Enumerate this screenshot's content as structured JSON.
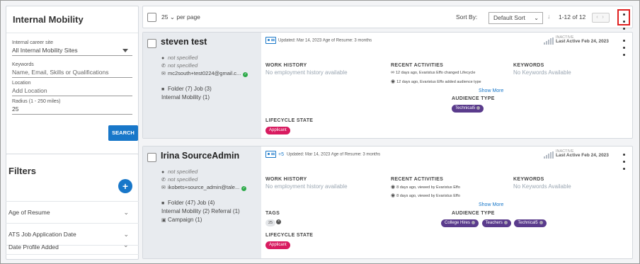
{
  "left": {
    "title": "Internal Mobility",
    "site_label": "Internal career site",
    "site_value": "All Internal Mobility Sites",
    "keywords_label": "Keywords",
    "keywords_placeholder": "Name, Email, Skills or Qualifications",
    "location_label": "Location",
    "location_placeholder": "Add Location",
    "radius_label": "Radius (1 - 250 miles)",
    "radius_value": "25",
    "search_label": "SEARCH",
    "filters_title": "Filters",
    "add_label": "+",
    "filters": [
      "Age of Resume",
      "ATS Job Application Date",
      "Date Profile Added"
    ]
  },
  "topbar": {
    "per_page": "25",
    "per_page_label": "per page",
    "sort_by": "Sort By:",
    "sort_value": "Default Sort",
    "pagination": "1-12 of 12"
  },
  "records": [
    {
      "name": "steven test",
      "location": "not specified",
      "phone": "not specified",
      "email": "mc2south+test0224@gmail.c...",
      "folder_job": "Folder (7)  Job (3)",
      "source1": "Internal Mobility (1)",
      "resume": "Updated: Mar 14, 2023  Age of Resume: 3 months",
      "status": "INACTIVE",
      "last_active": "Last Active Feb 24, 2023",
      "work_history_h": "WORK HISTORY",
      "work_history": "No employment history available",
      "recent_h": "RECENT ACTIVITIES",
      "act1": "12 days ago, Evaristus Effo changed Lifecycle",
      "act2": "12 days ago, Evaristus Effo added audience type",
      "show_more": "Show More",
      "keywords_h": "KEYWORDS",
      "keywords": "No Keywords Available",
      "audience_h": "AUDIENCE TYPE",
      "audience": [
        "Technical5"
      ],
      "lifecycle_h": "LIFECYCLE STATE",
      "lifecycle": "Applicant"
    },
    {
      "name": "Irina SourceAdmin",
      "location": "not specified",
      "phone": "not specified",
      "email": "ikobets+source_admin@tale...",
      "folder_job": "Folder (47)  Job (4)",
      "source1": "Internal Mobility (2)  Referral (1)",
      "source2": "Campaign (1)",
      "resume_plus": "+5",
      "resume": "Updated: Mar 14, 2023  Age of Resume: 3 months",
      "status": "INACTIVE",
      "last_active": "Last Active Feb 24, 2023",
      "work_history_h": "WORK HISTORY",
      "work_history": "No employment history available",
      "recent_h": "RECENT ACTIVITIES",
      "act1": "8 days ago, viewed by Evaristus Effo",
      "act2": "8 days ago, viewed by Evaristus Effo",
      "show_more": "Show More",
      "keywords_h": "KEYWORDS",
      "keywords": "No Keywords Available",
      "tags_h": "TAGS",
      "tag": "25",
      "audience_h": "AUDIENCE TYPE",
      "audience": [
        "College Hires",
        "Teachers",
        "Technical5"
      ],
      "lifecycle_h": "LIFECYCLE STATE",
      "lifecycle": "Applicant"
    }
  ],
  "colors": {
    "accent": "#1877c9",
    "purple": "#5a3b8c",
    "pink": "#d81b60",
    "highlight": "#e02020"
  }
}
